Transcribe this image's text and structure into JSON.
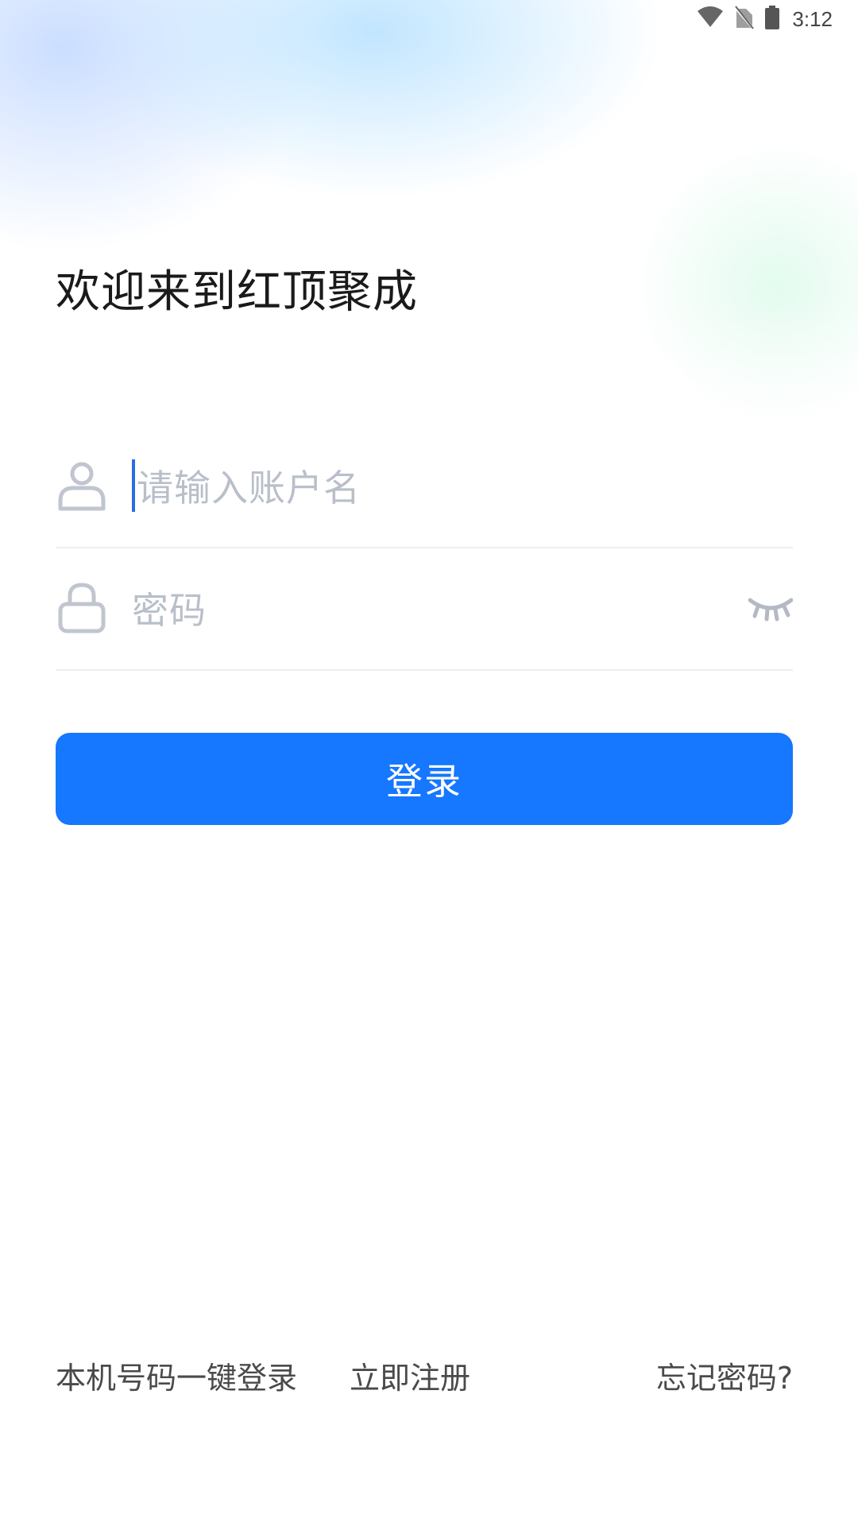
{
  "status_bar": {
    "time": "3:12",
    "icons": [
      "wifi-icon",
      "no-sim-icon",
      "battery-icon"
    ]
  },
  "header": {
    "title": "欢迎来到红顶聚成"
  },
  "form": {
    "username": {
      "placeholder": "请输入账户名",
      "value": "",
      "icon": "user-icon"
    },
    "password": {
      "placeholder": "密码",
      "value": "",
      "icon": "lock-icon",
      "toggle_icon": "eye-closed-icon"
    },
    "login_label": "登录"
  },
  "footer": {
    "phone_login": "本机号码一键登录",
    "register": "立即注册",
    "forgot_password": "忘记密码?"
  },
  "colors": {
    "primary": "#1677ff",
    "placeholder": "#b9bfca",
    "icon": "#c0c5cf",
    "caret": "#2b6be4"
  }
}
